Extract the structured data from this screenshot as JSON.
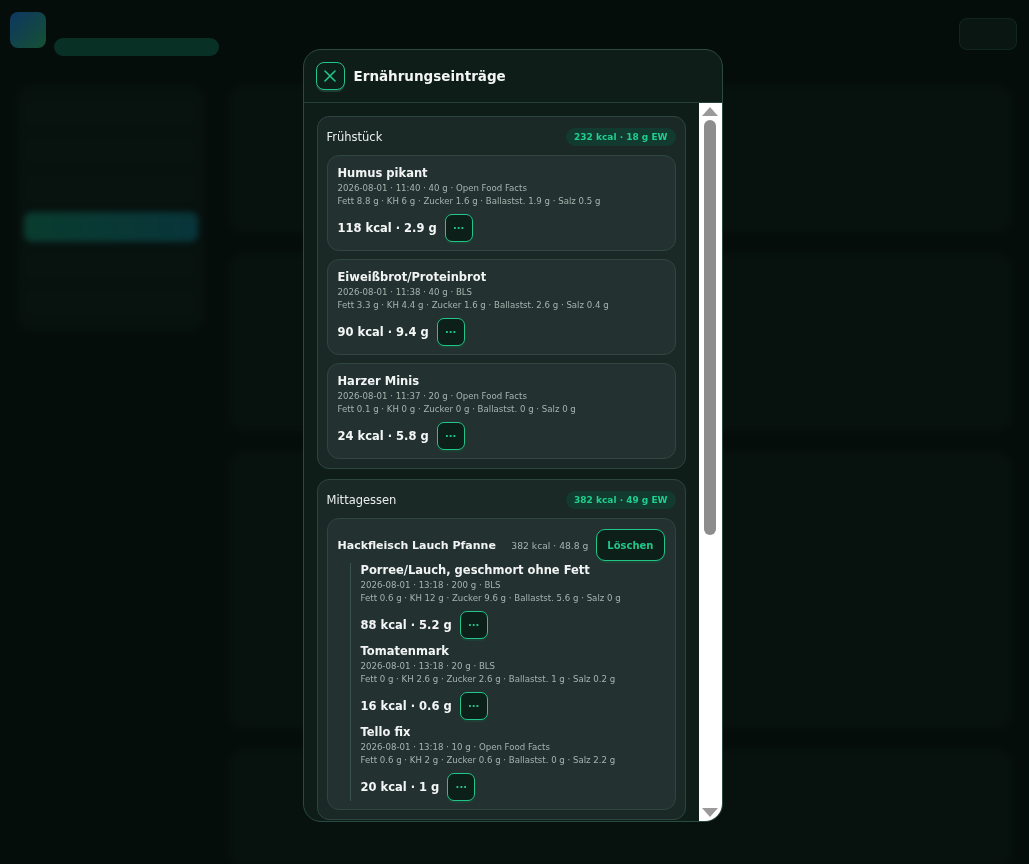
{
  "modal": {
    "title": "Ernährungseinträge"
  },
  "meals": [
    {
      "name": "Frühstück",
      "badge": "232 kcal · 18 g EW",
      "entries": [
        {
          "kind": "food",
          "name": "Humus pikant",
          "meta": "2026-08-01 · 11:40 · 40 g · Open Food Facts",
          "nutrients": "Fett 8.8 g · KH 6 g · Zucker 1.6 g · Ballastst. 1.9 g · Salz 0.5 g",
          "summary": "118 kcal · 2.9 g",
          "more": "···"
        },
        {
          "kind": "food",
          "name": "Eiweißbrot/Proteinbrot",
          "meta": "2026-08-01 · 11:38 · 40 g · BLS",
          "nutrients": "Fett 3.3 g · KH 4.4 g · Zucker 1.6 g · Ballastst. 2.6 g · Salz 0.4 g",
          "summary": "90 kcal · 9.4 g",
          "more": "···"
        },
        {
          "kind": "food",
          "name": "Harzer Minis",
          "meta": "2026-08-01 · 11:37 · 20 g · Open Food Facts",
          "nutrients": "Fett 0.1 g · KH 0 g · Zucker 0 g · Ballastst. 0 g · Salz 0 g",
          "summary": "24 kcal · 5.8 g",
          "more": "···"
        }
      ]
    },
    {
      "name": "Mittagessen",
      "badge": "382 kcal · 49 g EW",
      "entries": [
        {
          "kind": "recipe",
          "name": "Hackfleisch Lauch Pfanne",
          "total": "382 kcal · 48.8 g",
          "delete": "Löschen",
          "children": [
            {
              "name": "Porree/Lauch, geschmort ohne Fett",
              "meta": "2026-08-01 · 13:18 · 200 g · BLS",
              "nutrients": "Fett 0.6 g · KH 12 g · Zucker 9.6 g · Ballastst. 5.6 g · Salz 0 g",
              "summary": "88 kcal · 5.2 g",
              "more": "···"
            },
            {
              "name": "Tomatenmark",
              "meta": "2026-08-01 · 13:18 · 20 g · BLS",
              "nutrients": "Fett 0 g · KH 2.6 g · Zucker 2.6 g · Ballastst. 1 g · Salz 0.2 g",
              "summary": "16 kcal · 0.6 g",
              "more": "···"
            },
            {
              "name": "Tello fix",
              "meta": "2026-08-01 · 13:18 · 10 g · Open Food Facts",
              "nutrients": "Fett 0.6 g · KH 2 g · Zucker 0.6 g · Ballastst. 0 g · Salz 2.2 g",
              "summary": "20 kcal · 1 g",
              "more": "···"
            }
          ]
        }
      ]
    }
  ]
}
